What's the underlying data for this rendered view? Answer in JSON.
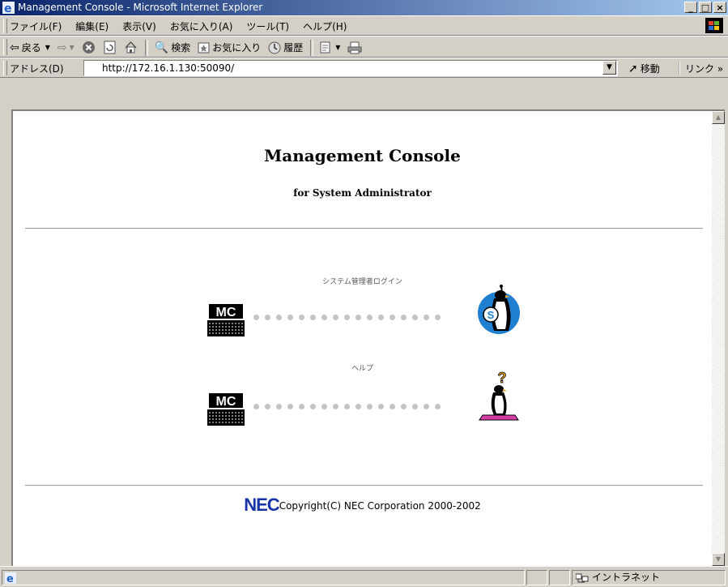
{
  "window": {
    "title": "Management Console - Microsoft Internet Explorer",
    "min_label": "_",
    "max_label": "□",
    "close_label": "×"
  },
  "menu": {
    "items": [
      "ファイル(F)",
      "編集(E)",
      "表示(V)",
      "お気に入り(A)",
      "ツール(T)",
      "ヘルプ(H)"
    ]
  },
  "toolbar": {
    "back_label": "戻る",
    "search_label": "検索",
    "favorites_label": "お気に入り",
    "history_label": "履歴"
  },
  "address": {
    "label": "アドレス(D)",
    "url": "http://172.16.1.130:50090/",
    "go_label": "移動",
    "links_label": "リンク »"
  },
  "page": {
    "title": "Management Console",
    "subtitle": "for System Administrator",
    "login_label": "システム管理者ログイン",
    "help_label": "ヘルプ",
    "mc_badge": "MC",
    "login_penguin_letter": "S",
    "help_penguin_mark": "?",
    "footer_brand": "NEC",
    "footer_text": "Copyright(C) NEC Corporation 2000-2002"
  },
  "status": {
    "zone_label": "イントラネット"
  },
  "colors": {
    "titlebar_start": "#0a246a",
    "titlebar_end": "#a6caf0",
    "nec_blue": "#1633a8",
    "admin_disc": "#1f7fd0",
    "help_base": "#d43ca8"
  }
}
